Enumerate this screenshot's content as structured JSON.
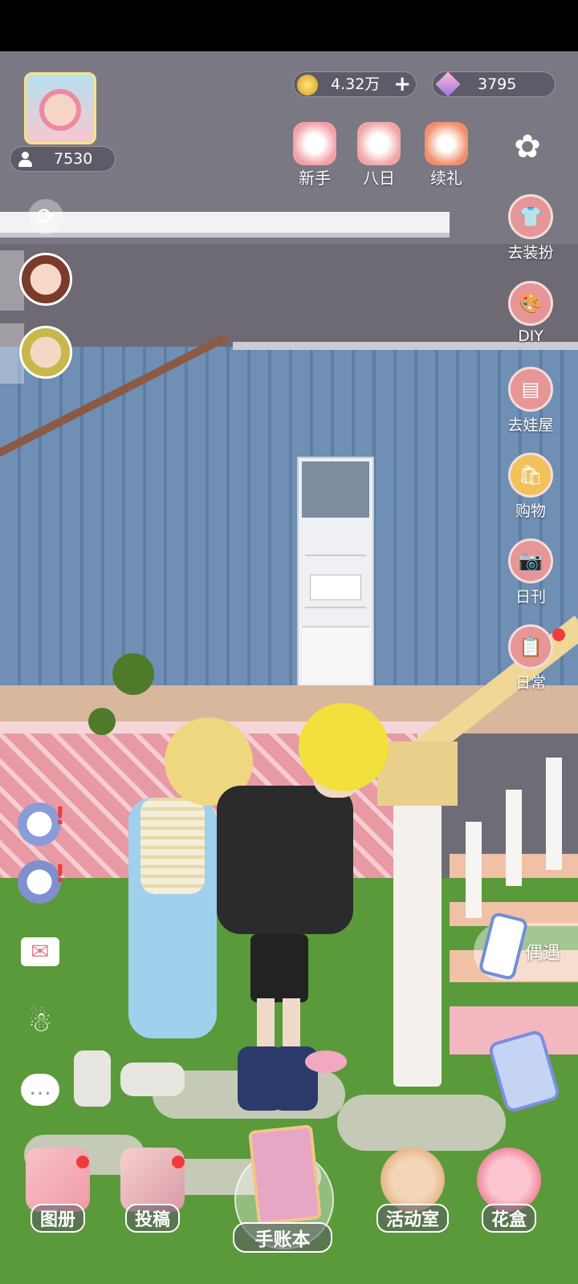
{
  "currency": {
    "coins": "4.32万",
    "gems": "3795"
  },
  "player": {
    "followers": "7530"
  },
  "top_events": [
    {
      "label": "新手"
    },
    {
      "label": "八日"
    },
    {
      "label": "续礼"
    }
  ],
  "side_menu": [
    {
      "label": "去装扮"
    },
    {
      "label": "DIY"
    },
    {
      "label": "去娃屋"
    },
    {
      "label": "购物"
    },
    {
      "label": "日刊"
    },
    {
      "label": "日常"
    }
  ],
  "encounter": {
    "label": "偶遇"
  },
  "bottom_nav": [
    {
      "label": "图册"
    },
    {
      "label": "投稿"
    },
    {
      "label": "手账本"
    },
    {
      "label": "活动室"
    },
    {
      "label": "花盒"
    }
  ],
  "colors": {
    "side_button": "#e69696",
    "badge": "#ef3b3b",
    "wall_blue": "#6f8fb4",
    "grass": "#5a9a3a"
  }
}
